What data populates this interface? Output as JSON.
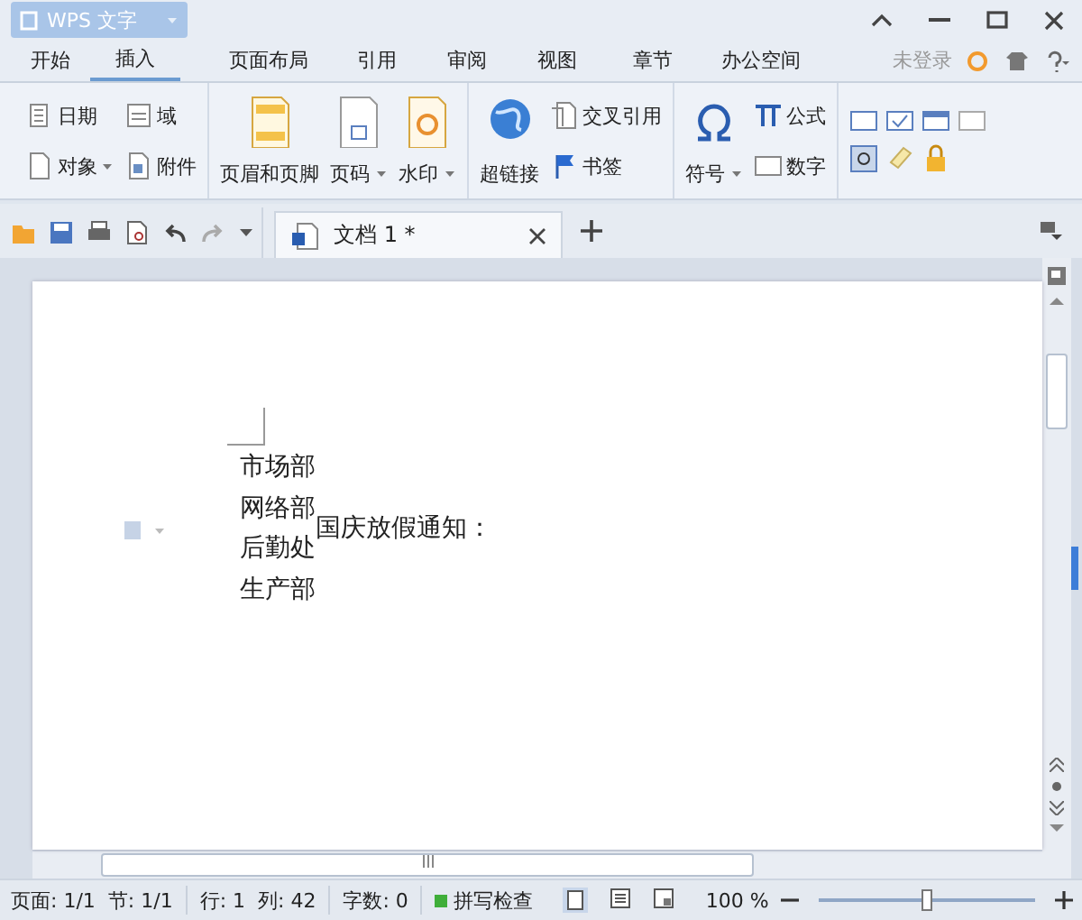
{
  "app_menu": {
    "label": "WPS 文字"
  },
  "menu_tabs": [
    {
      "label": "开始",
      "selected": false
    },
    {
      "label": "插入",
      "selected": true
    },
    {
      "label": "页面布局",
      "selected": false
    },
    {
      "label": "引用",
      "selected": false
    },
    {
      "label": "审阅",
      "selected": false
    },
    {
      "label": "视图",
      "selected": false
    },
    {
      "label": "章节",
      "selected": false
    },
    {
      "label": "办公空间",
      "selected": false
    }
  ],
  "account": {
    "label": "未登录"
  },
  "ribbon": {
    "groups": [
      {
        "items": [
          {
            "label": "日期",
            "kind": "small",
            "dropdown": false
          },
          {
            "label": "对象",
            "kind": "small",
            "dropdown": true
          },
          {
            "label": "域",
            "kind": "small",
            "dropdown": false
          },
          {
            "label": "附件",
            "kind": "small",
            "dropdown": false
          }
        ]
      },
      {
        "items": [
          {
            "label": "页眉和页脚",
            "kind": "large",
            "dropdown": false
          },
          {
            "label": "页码",
            "kind": "large",
            "dropdown": true
          },
          {
            "label": "水印",
            "kind": "large",
            "dropdown": true
          }
        ]
      },
      {
        "items": [
          {
            "label": "超链接",
            "kind": "large",
            "dropdown": false
          },
          {
            "label": "交叉引用",
            "kind": "small",
            "dropdown": false
          },
          {
            "label": "书签",
            "kind": "small",
            "dropdown": false
          }
        ]
      },
      {
        "items": [
          {
            "label": "符号",
            "kind": "large",
            "dropdown": true
          },
          {
            "label": "公式",
            "kind": "small",
            "dropdown": false
          },
          {
            "label": "数字",
            "kind": "small",
            "dropdown": false
          }
        ]
      }
    ]
  },
  "doc_tabs": [
    {
      "label": "文档 1 *",
      "selected": true
    }
  ],
  "document": {
    "lines": [
      "市场部",
      "网络部",
      "后勤处",
      "生产部"
    ],
    "heading": "国庆放假通知："
  },
  "status_bar": {
    "fields": [
      "页面: 1/1",
      "节: 1/1",
      "行: 1",
      "列: 42",
      "字数: 0"
    ],
    "spell_check": {
      "label": "拼写检查",
      "on": true
    },
    "zoom": {
      "reading": "100 %",
      "level": 0.5
    }
  }
}
